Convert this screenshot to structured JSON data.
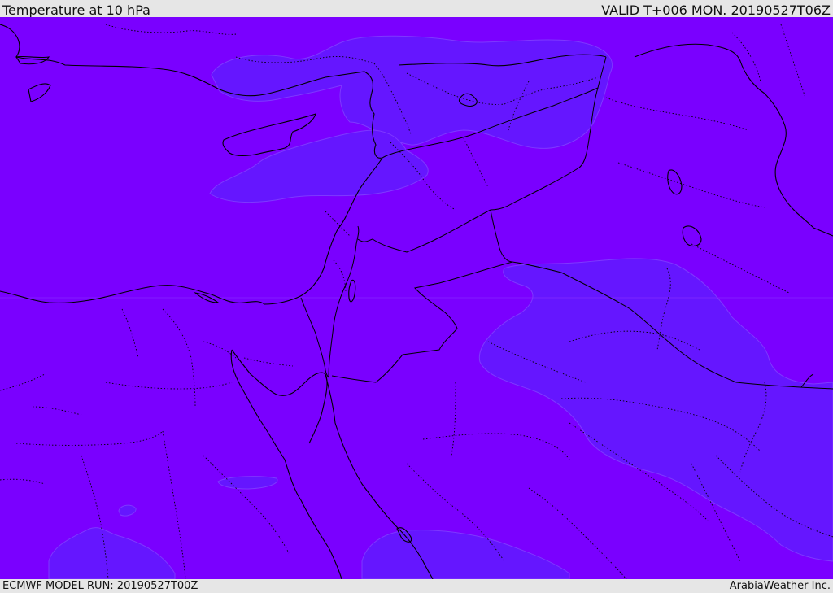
{
  "header": {
    "title": "Temperature at 10 hPa",
    "valid": "VALID T+006 MON. 20190527T06Z"
  },
  "footer": {
    "model_run": "ECMWF MODEL RUN: 20190527T00Z",
    "credit": "ArabiaWeather Inc."
  },
  "map": {
    "field": "temperature",
    "level": "10 hPa",
    "base_color": "#7a00ff",
    "warmer_patch_color": "#6418ff",
    "coastline_color": "#000000",
    "border_color": "#000000",
    "admin_border_style": "dotted"
  }
}
